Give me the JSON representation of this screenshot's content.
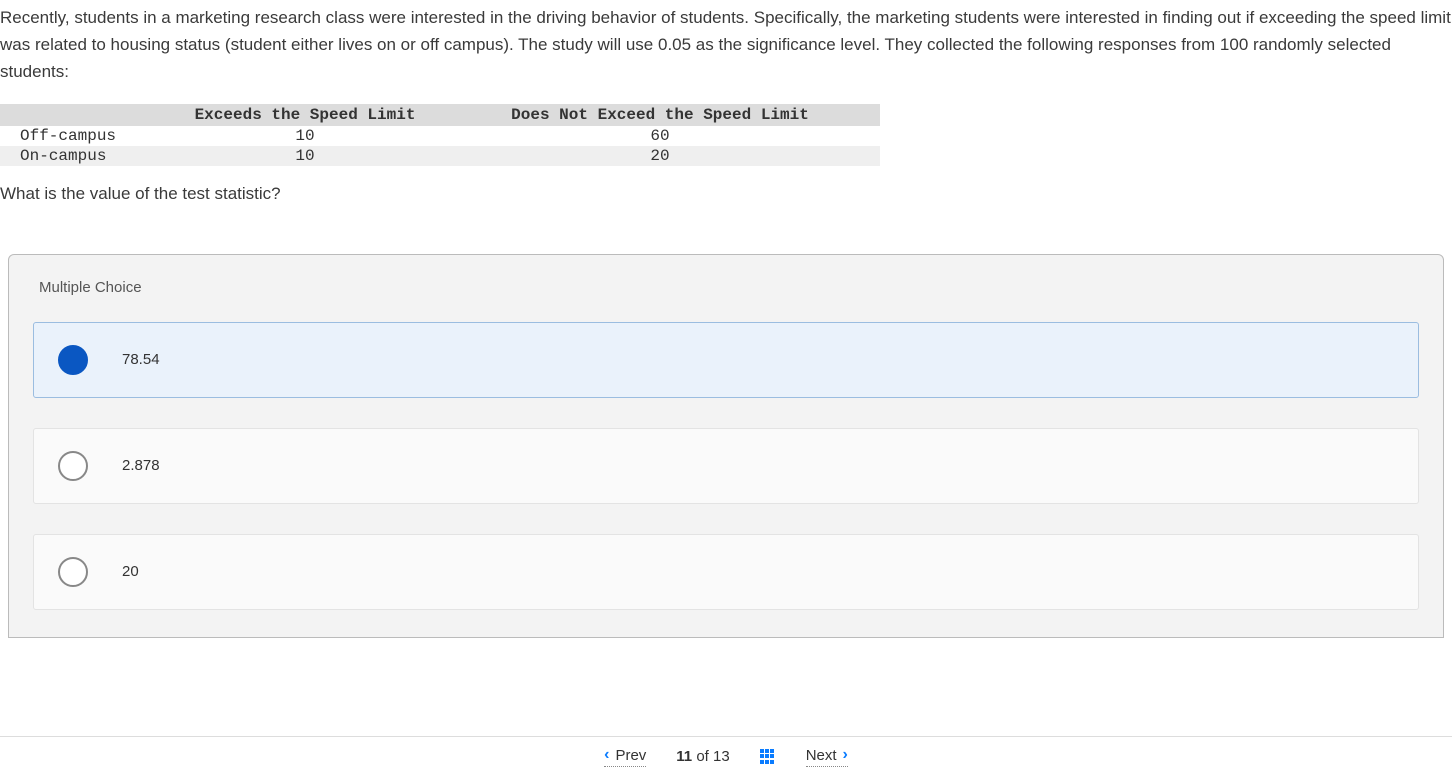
{
  "prompt": {
    "paragraph": "Recently, students in a marketing research class were interested in the driving behavior of students. Specifically, the marketing students were interested in finding out if exceeding the speed limit was related to housing status (student either lives on or off campus). The study will use 0.05 as the significance level. They collected the following responses from 100 randomly selected students:"
  },
  "table": {
    "headers": {
      "blank": "",
      "col1": "Exceeds the Speed Limit",
      "col2": "Does Not Exceed the Speed Limit"
    },
    "rows": [
      {
        "label": "Off-campus",
        "c1": "10",
        "c2": "60"
      },
      {
        "label": "On-campus",
        "c1": "10",
        "c2": "20"
      }
    ]
  },
  "question": "What is the value of the test statistic?",
  "answers": {
    "heading": "Multiple Choice",
    "options": [
      {
        "label": "78.54",
        "selected": true
      },
      {
        "label": "2.878",
        "selected": false
      },
      {
        "label": "20",
        "selected": false
      }
    ]
  },
  "nav": {
    "prev": "Prev",
    "next": "Next",
    "current": "11",
    "of": "of",
    "total": "13"
  }
}
